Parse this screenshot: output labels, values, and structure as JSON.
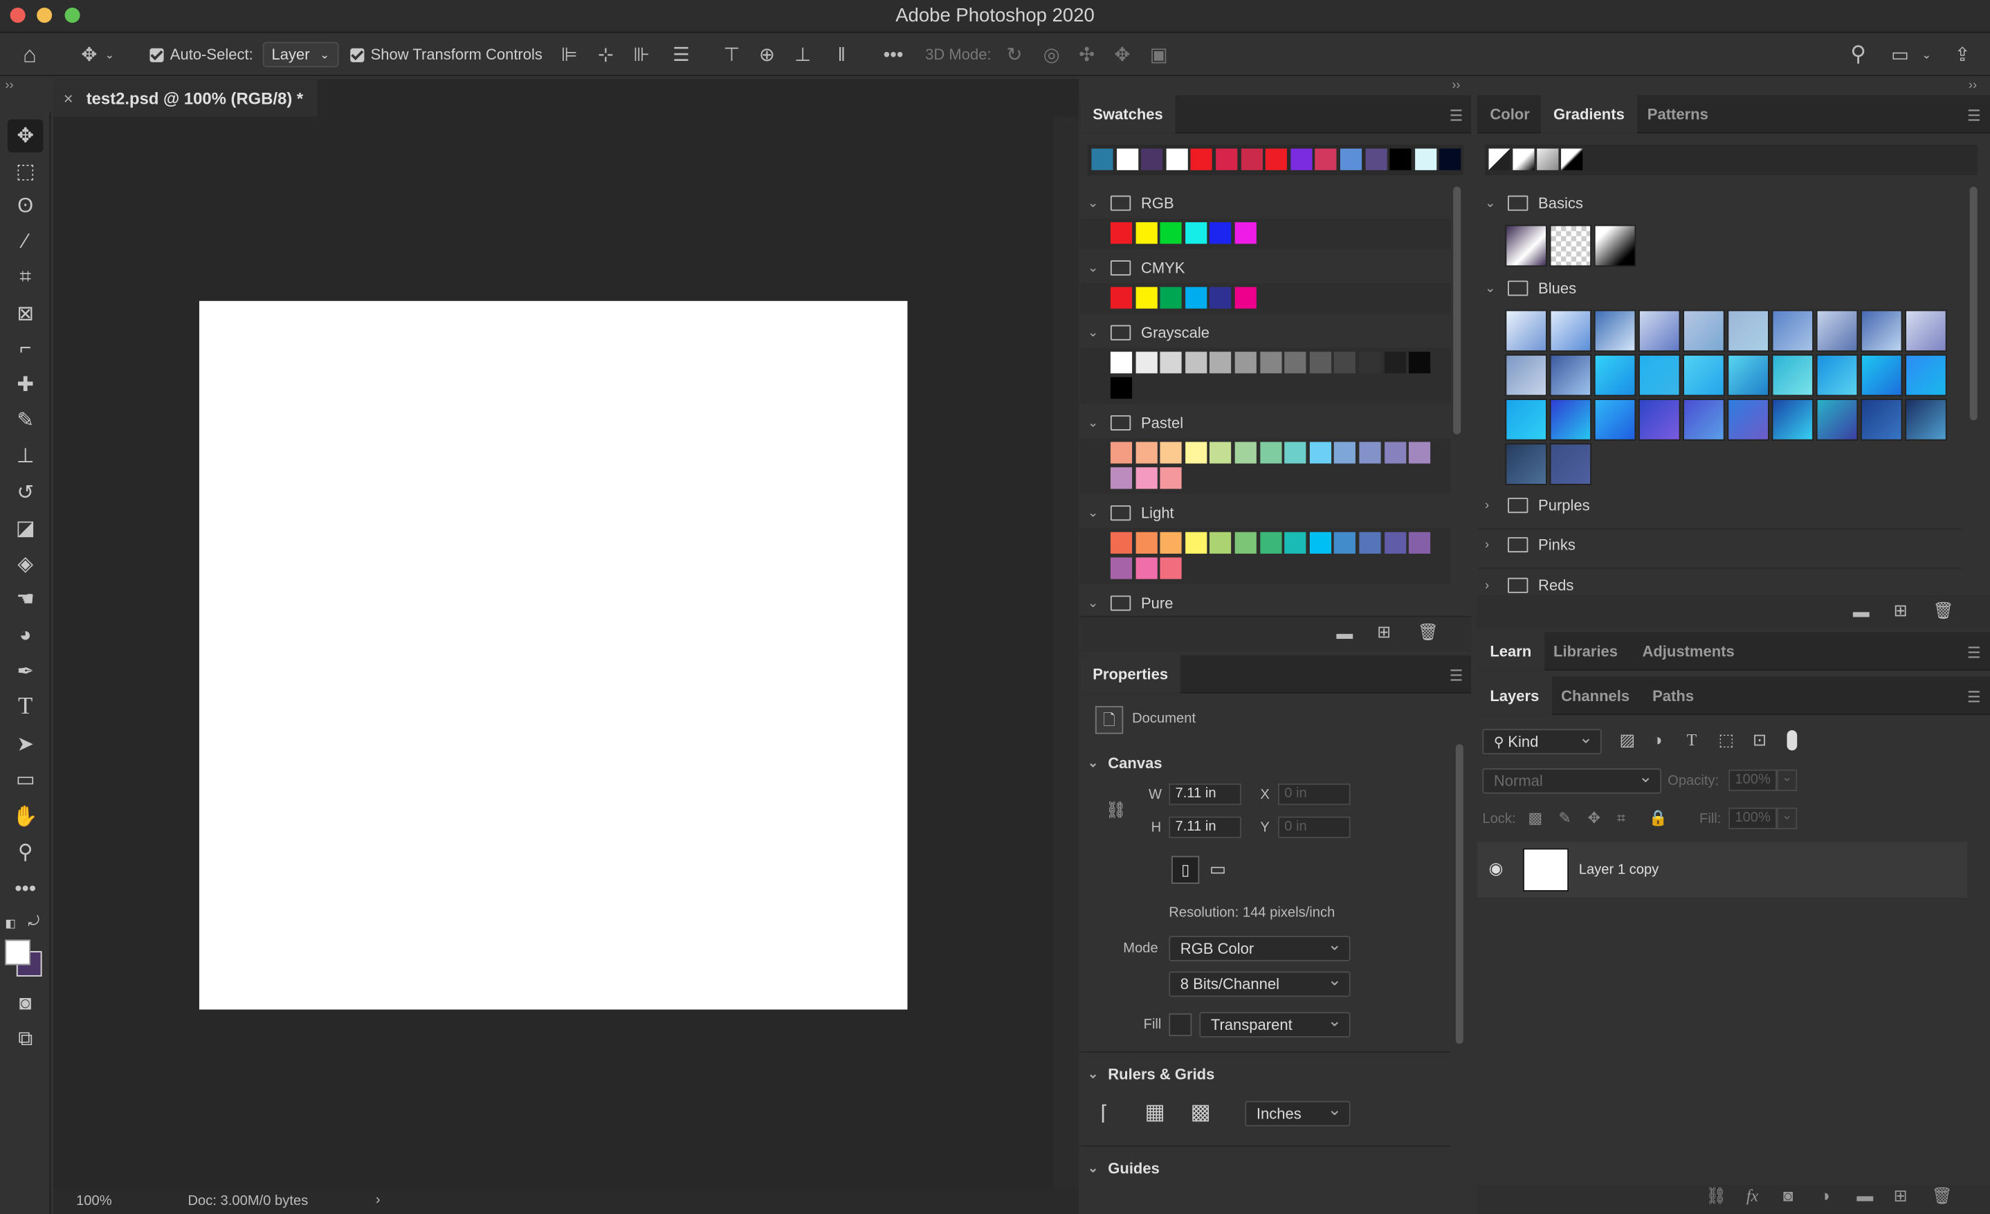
{
  "window": {
    "title": "Adobe Photoshop 2020"
  },
  "options_bar": {
    "auto_select_label": "Auto-Select:",
    "auto_select_value": "Layer",
    "show_transform_label": "Show Transform Controls",
    "mode_3d_label": "3D Mode:"
  },
  "document": {
    "tab_title": "test2.psd @ 100% (RGB/8) *",
    "close_glyph": "×"
  },
  "status": {
    "zoom": "100%",
    "doc_info": "Doc: 3.00M/0 bytes"
  },
  "swatches_panel": {
    "tab": "Swatches",
    "recent": [
      "#2a7ba3",
      "#ffffff",
      "#4a3566",
      "#ffffff",
      "#ef1c24",
      "#d6244a",
      "#cc2a4a",
      "#ee1c24",
      "#7b2be0",
      "#d2385e",
      "#5b8fd8",
      "#5a4a85",
      "#000000",
      "#d8f6fa",
      "#030a24"
    ],
    "groups": [
      {
        "name": "RGB",
        "colors": [
          "#ef1c24",
          "#fff200",
          "#00d62e",
          "#15ede9",
          "#1c24ef",
          "#ef1ce7"
        ]
      },
      {
        "name": "CMYK",
        "colors": [
          "#ed1c24",
          "#fff200",
          "#00a651",
          "#00aeef",
          "#2e3192",
          "#ec008c"
        ]
      },
      {
        "name": "Grayscale",
        "colors": [
          "#ffffff",
          "#ebebeb",
          "#d6d6d6",
          "#c2c2c2",
          "#adadad",
          "#999999",
          "#858585",
          "#707070",
          "#5c5c5c",
          "#474747",
          "#333333",
          "#1f1f1f",
          "#0a0a0a",
          "#000000"
        ]
      },
      {
        "name": "Pastel",
        "colors": [
          "#f59d82",
          "#f8b08a",
          "#fcc98e",
          "#fff59b",
          "#c4de93",
          "#a3d39c",
          "#7fcca1",
          "#6dcfc9",
          "#6ccff6",
          "#7ea7d8",
          "#8393ca",
          "#8781bd",
          "#a187be",
          "#bd8cbf",
          "#f49ac1",
          "#f5989d"
        ]
      },
      {
        "name": "Light",
        "colors": [
          "#f26c4f",
          "#f68e56",
          "#fbaf5d",
          "#fff467",
          "#acd372",
          "#7cc576",
          "#3bb878",
          "#1abbb4",
          "#00bff3",
          "#438ccb",
          "#5574b9",
          "#605ca8",
          "#855fa8",
          "#a763a8",
          "#f06ea9",
          "#f26d7d"
        ]
      },
      {
        "name": "Pure",
        "colors": []
      }
    ]
  },
  "gradients_panel": {
    "tabs": [
      "Color",
      "Gradients",
      "Patterns"
    ],
    "groups": [
      {
        "name": "Basics",
        "expanded": true
      },
      {
        "name": "Blues",
        "expanded": true
      },
      {
        "name": "Purples",
        "expanded": false
      },
      {
        "name": "Pinks",
        "expanded": false
      },
      {
        "name": "Reds",
        "expanded": false
      }
    ]
  },
  "properties_panel": {
    "tab": "Properties",
    "doc_label": "Document",
    "canvas_section": "Canvas",
    "w_label": "W",
    "w_value": "7.11 in",
    "h_label": "H",
    "h_value": "7.11 in",
    "x_label": "X",
    "x_placeholder": "0 in",
    "y_label": "Y",
    "y_placeholder": "0 in",
    "resolution": "Resolution: 144 pixels/inch",
    "mode_label": "Mode",
    "mode_value": "RGB Color",
    "bits_value": "8 Bits/Channel",
    "fill_label": "Fill",
    "fill_value": "Transparent",
    "rulers_section": "Rulers & Grids",
    "units_value": "Inches",
    "guides_section": "Guides"
  },
  "learn_panel": {
    "tabs": [
      "Learn",
      "Libraries",
      "Adjustments"
    ]
  },
  "layers_panel": {
    "tabs": [
      "Layers",
      "Channels",
      "Paths"
    ],
    "kind_label": "Kind",
    "blend_mode": "Normal",
    "opacity_label": "Opacity:",
    "opacity_value": "100%",
    "lock_label": "Lock:",
    "fill_label": "Fill:",
    "fill_value": "100%",
    "layers": [
      {
        "name": "Layer 1 copy",
        "visible": true
      }
    ],
    "footer_fx": "fx"
  }
}
